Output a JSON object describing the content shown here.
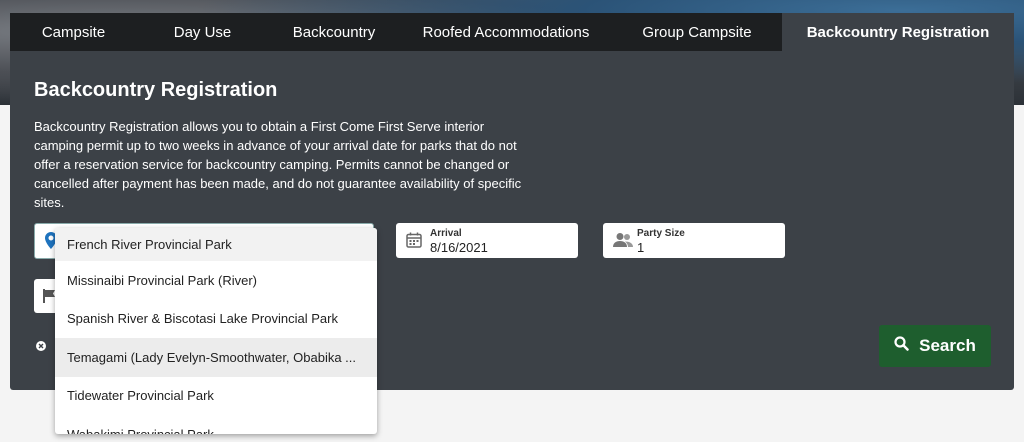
{
  "tabs": [
    {
      "label": "Campsite"
    },
    {
      "label": "Day Use"
    },
    {
      "label": "Backcountry"
    },
    {
      "label": "Roofed Accommodations"
    },
    {
      "label": "Group Campsite"
    },
    {
      "label": "Backcountry Registration"
    }
  ],
  "panel": {
    "title": "Backcountry Registration",
    "description": "Backcountry Registration allows you to obtain a First Come First Serve interior camping permit up to two weeks in advance of your arrival date for parks that do not offer a reservation service for backcountry camping. Permits cannot be changed or cancelled after payment has been made, and do not guarantee availability of specific sites."
  },
  "arrival": {
    "label": "Arrival",
    "value": "8/16/2021"
  },
  "party": {
    "label": "Party Size",
    "value": "1"
  },
  "search": {
    "label": "Search"
  },
  "dropdown": {
    "options": [
      "French River Provincial Park",
      "Missinaibi Provincial Park (River)",
      "Spanish River & Biscotasi Lake Provincial Park",
      "Temagami (Lady Evelyn-Smoothwater, Obabika ...",
      "Tidewater Provincial Park",
      "Wabakimi Provincial Park"
    ]
  },
  "colors": {
    "accent": "#1e5e2e",
    "pin": "#1e73be"
  }
}
